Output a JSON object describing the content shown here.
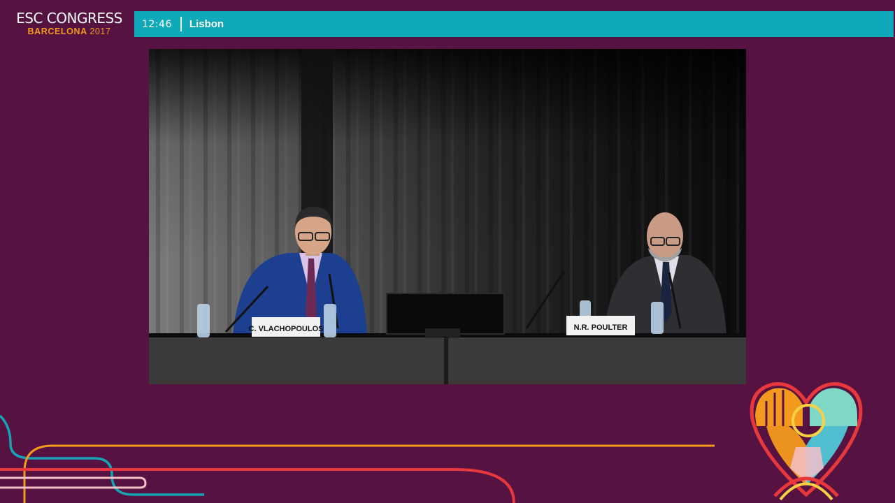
{
  "brand": {
    "title": "ESC CONGRESS",
    "city": "BARCELONA",
    "year": "2017",
    "accent_color": "#f39a1e",
    "background_color": "#561240"
  },
  "topbar": {
    "time": "12:46",
    "location": "Lisbon",
    "color": "#0fa9ba"
  },
  "video": {
    "speakers": [
      {
        "name_card": "C. VLACHOPOULOS"
      },
      {
        "name_card": "N.R. POULTER"
      }
    ]
  }
}
